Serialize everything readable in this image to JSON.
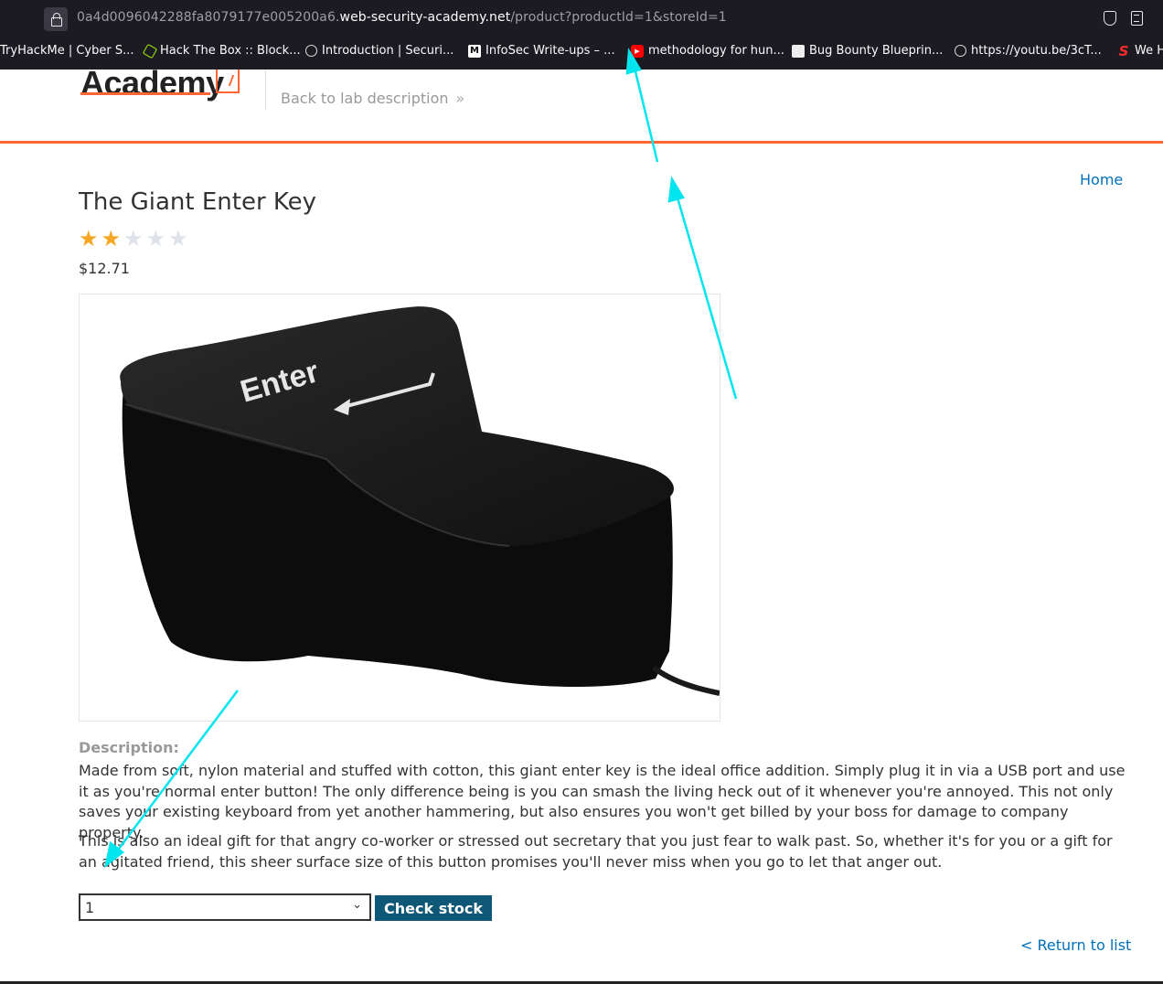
{
  "browser": {
    "url_prefix": "0a4d0096042288fa8079177e005200a6.",
    "url_domain": "web-security-academy.net",
    "url_path": "/product?productId=1&storeId=1",
    "bookmarks": [
      {
        "label": "TryHackMe | Cyber S...",
        "icon": ""
      },
      {
        "label": "Hack The Box :: Block...",
        "icon": "hex-icon"
      },
      {
        "label": "Introduction | Securi...",
        "icon": "globe-gear-icon"
      },
      {
        "label": "InfoSec Write-ups – ...",
        "icon": "medium-icon"
      },
      {
        "label": "methodology for hun...",
        "icon": "youtube-icon"
      },
      {
        "label": "Bug Bounty Blueprin...",
        "icon": "doc-icon"
      },
      {
        "label": "https://youtu.be/3cT...",
        "icon": "globe-icon"
      },
      {
        "label": "We H",
        "icon": "red-s-icon"
      }
    ]
  },
  "header": {
    "logo_text": "Academy",
    "back_link": "Back to lab description",
    "back_chevron": "»",
    "accent_color": "#ff6633"
  },
  "page": {
    "home_link": "Home",
    "product_title": "The Giant Enter Key",
    "rating": 2,
    "rating_max": 5,
    "price": "$12.71",
    "image_key_label": "Enter",
    "description_label": "Description:",
    "description_p1": "Made from soft, nylon material and stuffed with cotton, this giant enter key is the ideal office addition. Simply plug it in via a USB port and use it as you're normal enter button! The only difference being is you can smash the living heck out of it whenever you're annoyed. This not only saves your existing keyboard from yet another hammering, but also ensures you won't get billed by your boss for damage to company property.",
    "description_p2": "This is also an ideal gift for that angry co-worker or stressed out secretary that you just fear to walk past. So, whether it's for you or a gift for an agitated friend, this sheer surface size of this button promises you'll never miss when you go to let that anger out.",
    "stock_select_value": "1",
    "check_stock_label": "Check stock",
    "return_link": "< Return to list"
  },
  "colors": {
    "link": "#0071bc",
    "button": "#0e5777",
    "star_on": "#f5a623",
    "star_off": "#dde3e8",
    "annotation_arrow": "#00e5ee"
  }
}
